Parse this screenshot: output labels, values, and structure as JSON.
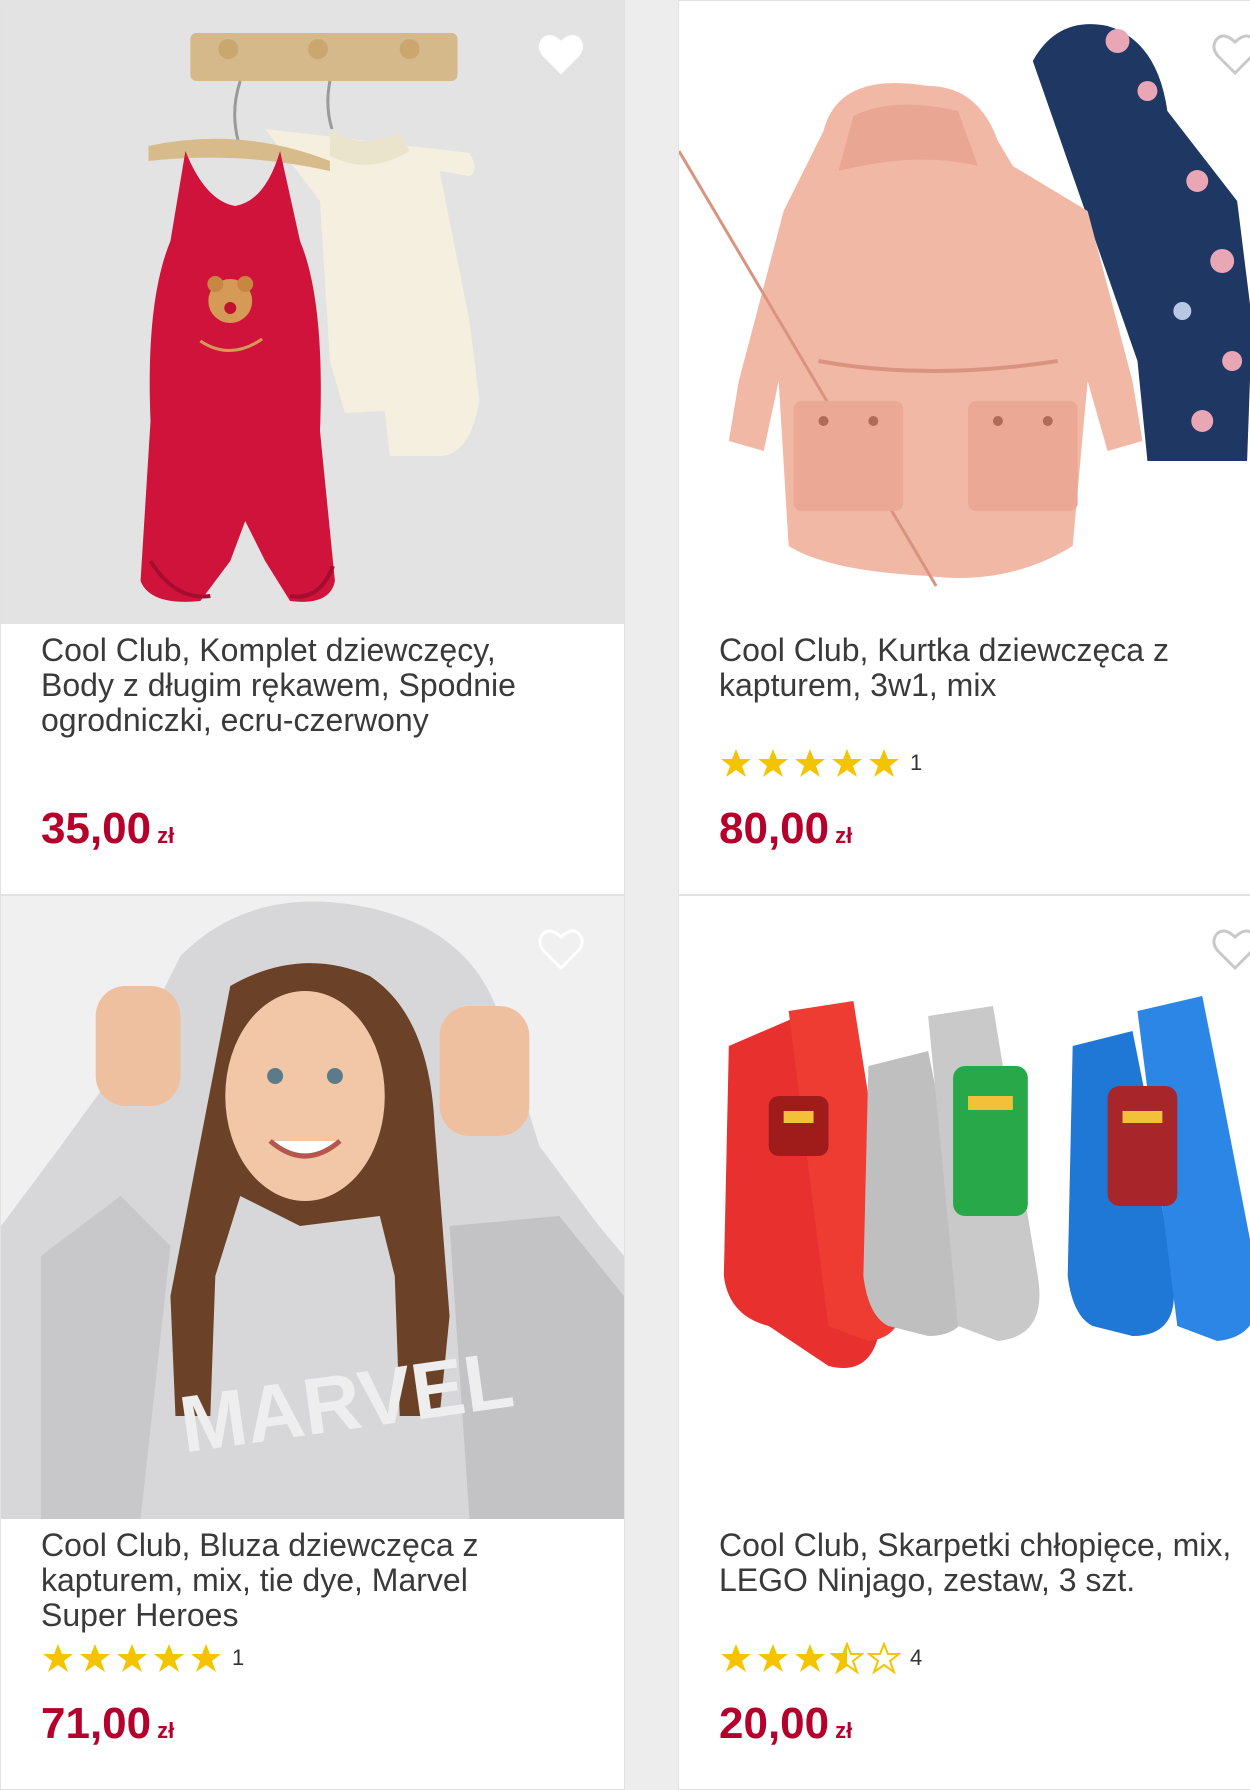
{
  "colors": {
    "price": "#b6002c",
    "star": "#f5c400",
    "background": "#ededed"
  },
  "products": [
    {
      "name": "Cool Club, Komplet dziewczęcy,\nBody z długim rękawem, Spodnie\nogrodniczki, ecru-czerwony",
      "price": "35,00",
      "currency": "zł",
      "rating": null,
      "rating_count": "",
      "favorite_icon": "heart-outline-icon",
      "image": "red-velvet-romper-and-ecru-bodysuit"
    },
    {
      "name": "Cool Club, Kurtka dziewczęca z\nkapturem, 3w1, mix",
      "price": "80,00",
      "currency": "zł",
      "rating": 5,
      "rating_count": "1",
      "favorite_icon": "heart-outline-icon",
      "image": "pink-parka-and-floral-jacket"
    },
    {
      "name": "Cool Club, Bluza dziewczęca z\nkapturem, mix, tie dye, Marvel\nSuper Heroes",
      "price": "71,00",
      "currency": "zł",
      "rating": 5,
      "rating_count": "1",
      "favorite_icon": "heart-outline-icon",
      "image": "girl-in-tie-dye-marvel-hoodie"
    },
    {
      "name": "Cool Club, Skarpetki chłopięce, mix,\nLEGO Ninjago, zestaw, 3 szt.",
      "price": "20,00",
      "currency": "zł",
      "rating": 3.5,
      "rating_count": "4",
      "favorite_icon": "heart-outline-icon",
      "image": "three-lego-ninjago-socks"
    }
  ]
}
